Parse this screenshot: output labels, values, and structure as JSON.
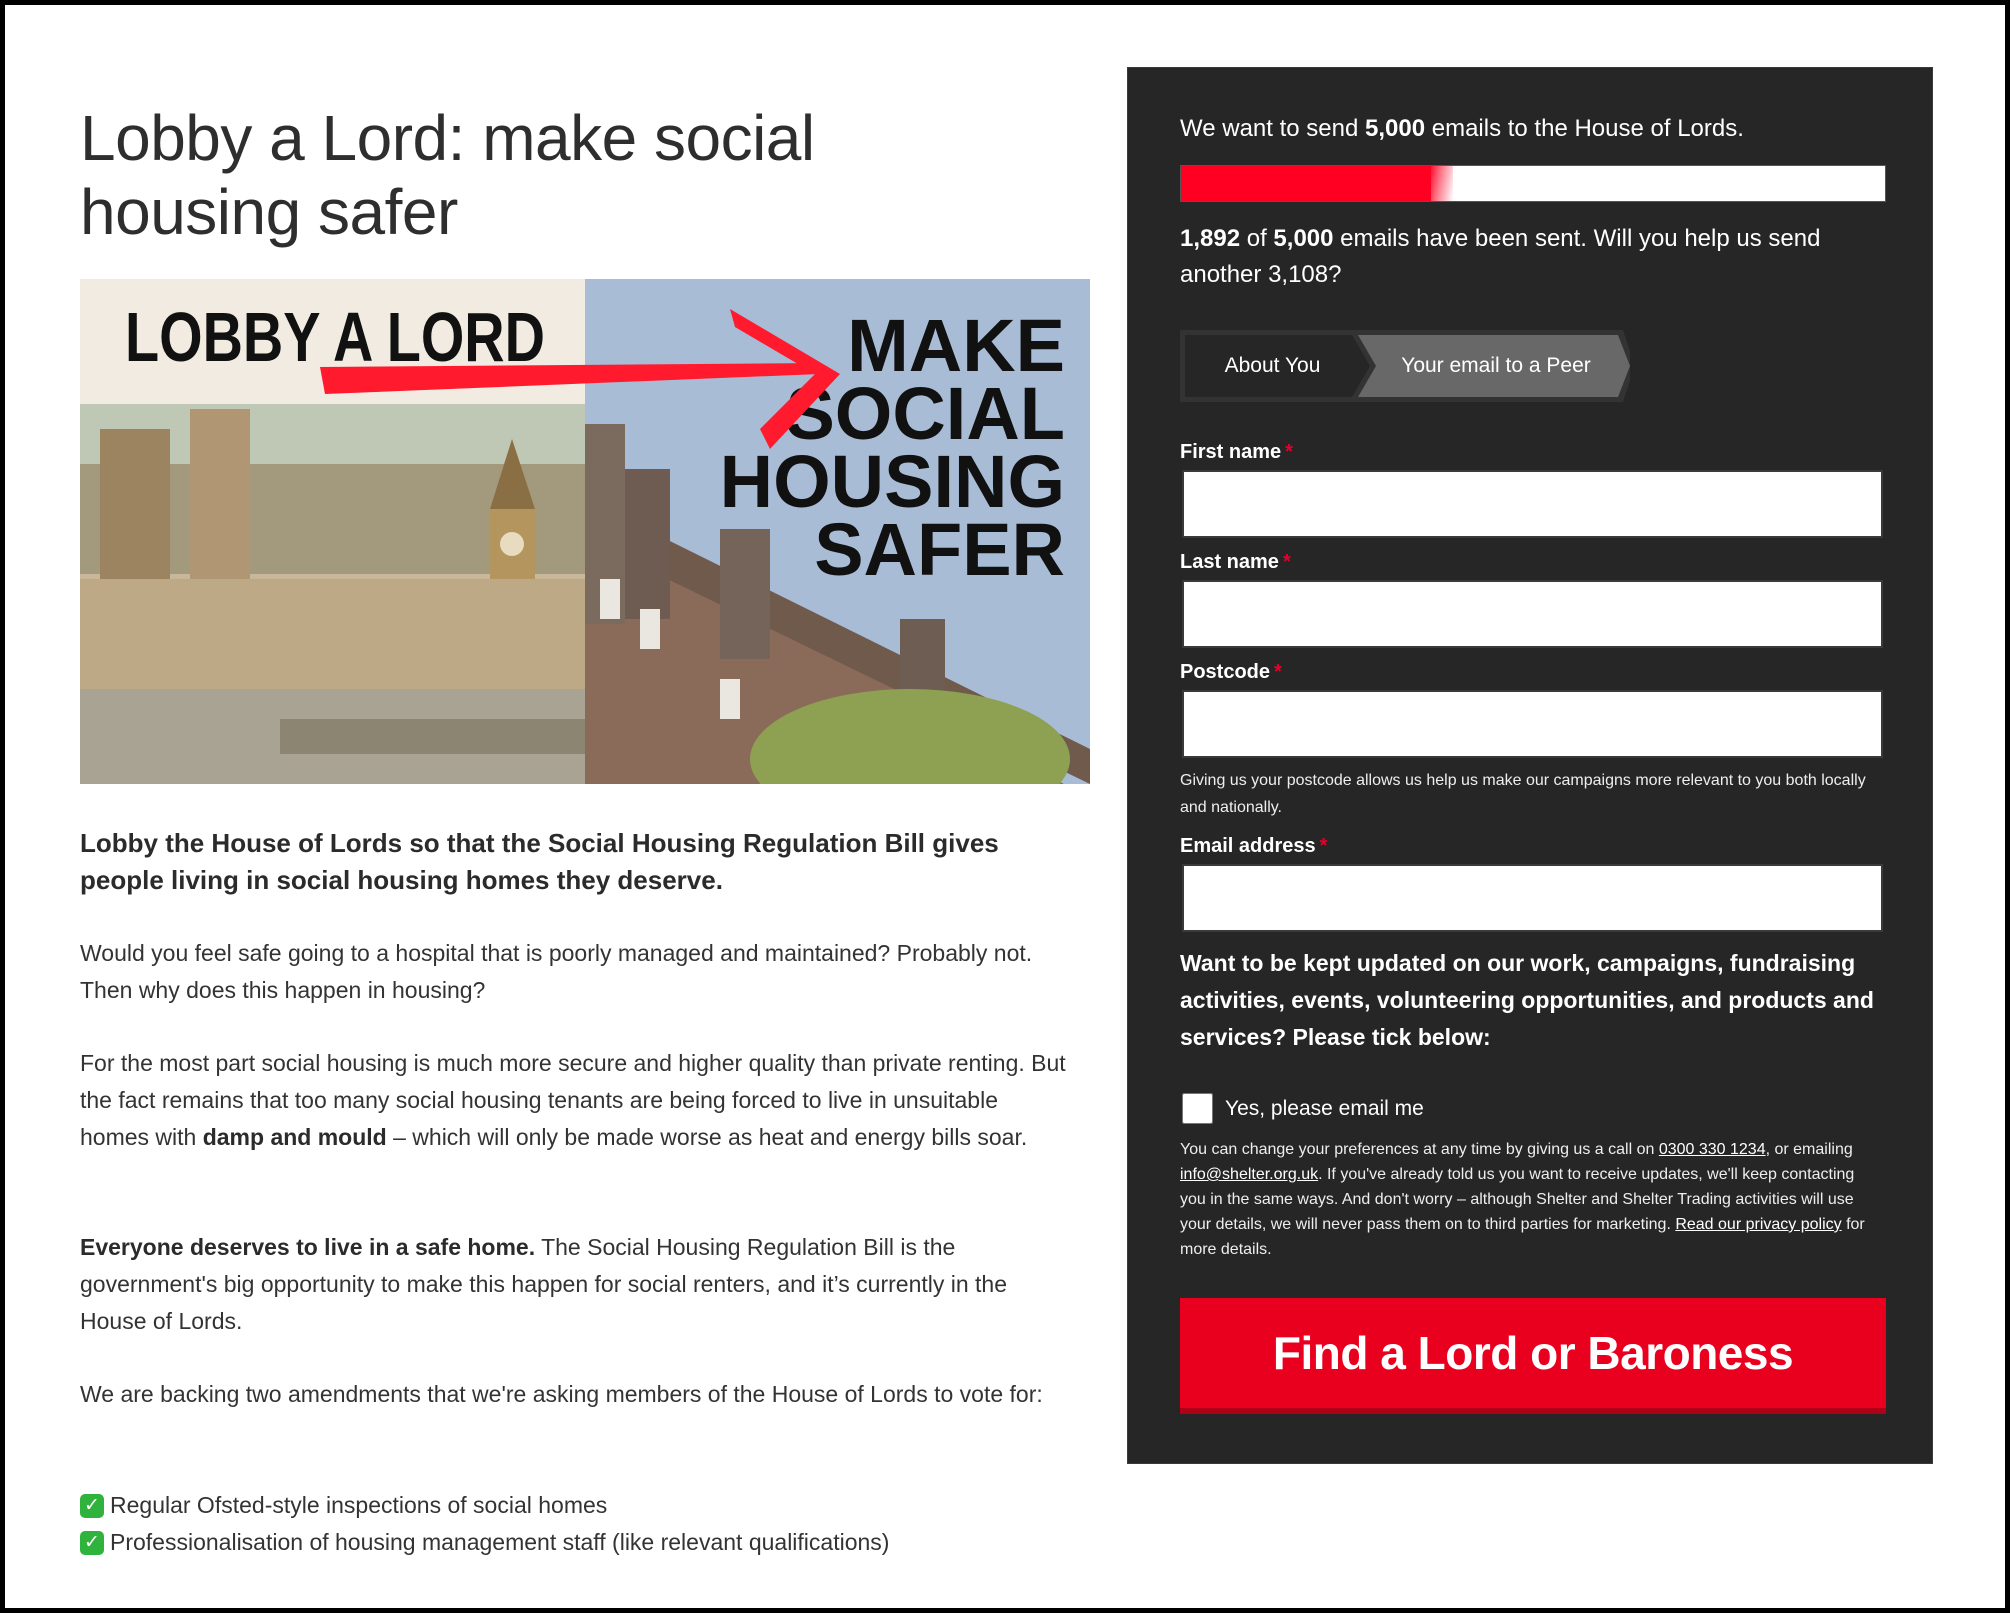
{
  "page": {
    "title": "Lobby a Lord: make social housing safer"
  },
  "hero": {
    "alt": "Lobby a Lord - Make social housing safer",
    "left_caption": "LOBBY A LORD",
    "right_caption_lines": [
      "MAKE",
      "SOCIAL",
      "HOUSING",
      "SAFER"
    ],
    "colors": {
      "arrow": "#ff1a2e",
      "sky": "#a9bcd6",
      "cream": "#f1ebe1"
    }
  },
  "content": {
    "lead": "Lobby the House of Lords so that the Social Housing Regulation Bill gives people living in social housing homes they deserve.",
    "p1": "Would you feel safe going to a hospital that is poorly managed and maintained? Probably not. Then why does this happen in housing?",
    "p2_start": "For the most part social housing is much more secure and higher quality than private renting. But the fact remains that too many social housing tenants are being forced to live in unsuitable homes with ",
    "p2_bold": "damp and mould",
    "p2_end": " – which will only be made worse as heat and energy bills soar.",
    "p3_bold": "Everyone deserves to live in a safe home.",
    "p3_rest": " The Social Housing Regulation Bill is the government's big opportunity to make this happen for social renters, and it’s currently in the House of Lords.",
    "p4": "We are backing two amendments that we're asking members of the House of Lords to vote for:",
    "amendments": [
      {
        "icon": "check-mark-button-icon",
        "glyph": "✓",
        "text": "Regular Ofsted-style inspections of social homes"
      },
      {
        "icon": "check-mark-button-icon",
        "glyph": "✓",
        "text": "Professionalisation of housing management staff (like relevant qualifications)"
      }
    ]
  },
  "progress": {
    "goal_prefix": "We want to send ",
    "goal_value": "5,000",
    "goal_suffix": " emails to the House of Lords.",
    "sent": "1,892",
    "of_text": " of ",
    "target": "5,000",
    "status_suffix": " emails have been sent. Will you help us send another 3,108?",
    "sent_count": 1892,
    "target_count": 5000,
    "fill_color": "#ff0022"
  },
  "stepper": {
    "steps": [
      {
        "label": "About You",
        "active": false
      },
      {
        "label": "Your email to a Peer",
        "active": true
      }
    ]
  },
  "form": {
    "required_marker": "*",
    "first_name": {
      "label": "First name",
      "value": "",
      "placeholder": ""
    },
    "last_name": {
      "label": "Last name",
      "value": "",
      "placeholder": ""
    },
    "postcode": {
      "label": "Postcode",
      "value": "",
      "placeholder": "",
      "hint": "Giving us your postcode allows us help us make our campaigns more relevant to you both locally and nationally."
    },
    "email": {
      "label": "Email address",
      "value": "",
      "placeholder": ""
    },
    "optin_question": "Want to be kept updated on our work, campaigns, fundraising activities, events, volunteering opportunities, and products and services? Please tick below:",
    "optin_label": "Yes, please email me",
    "optin_checked": false,
    "privacy": {
      "t1": "You can change your preferences at any time by giving us a call on ",
      "phone": "0300 330 1234",
      "t2": ", or emailing ",
      "email": "info@shelter.org.uk",
      "t3": ". If you've already told us you want to receive updates, we'll keep contacting you in the same ways. And don't worry – although Shelter and Shelter Trading activities will use your details, we will never pass them on to third parties for marketing. ",
      "policy_link": "Read our privacy policy",
      "t4": " for more details."
    },
    "submit_label": "Find a Lord or Baroness"
  },
  "colors": {
    "panel_bg": "#262626",
    "brand_red": "#e8001e",
    "step_active_bg": "#686868"
  }
}
